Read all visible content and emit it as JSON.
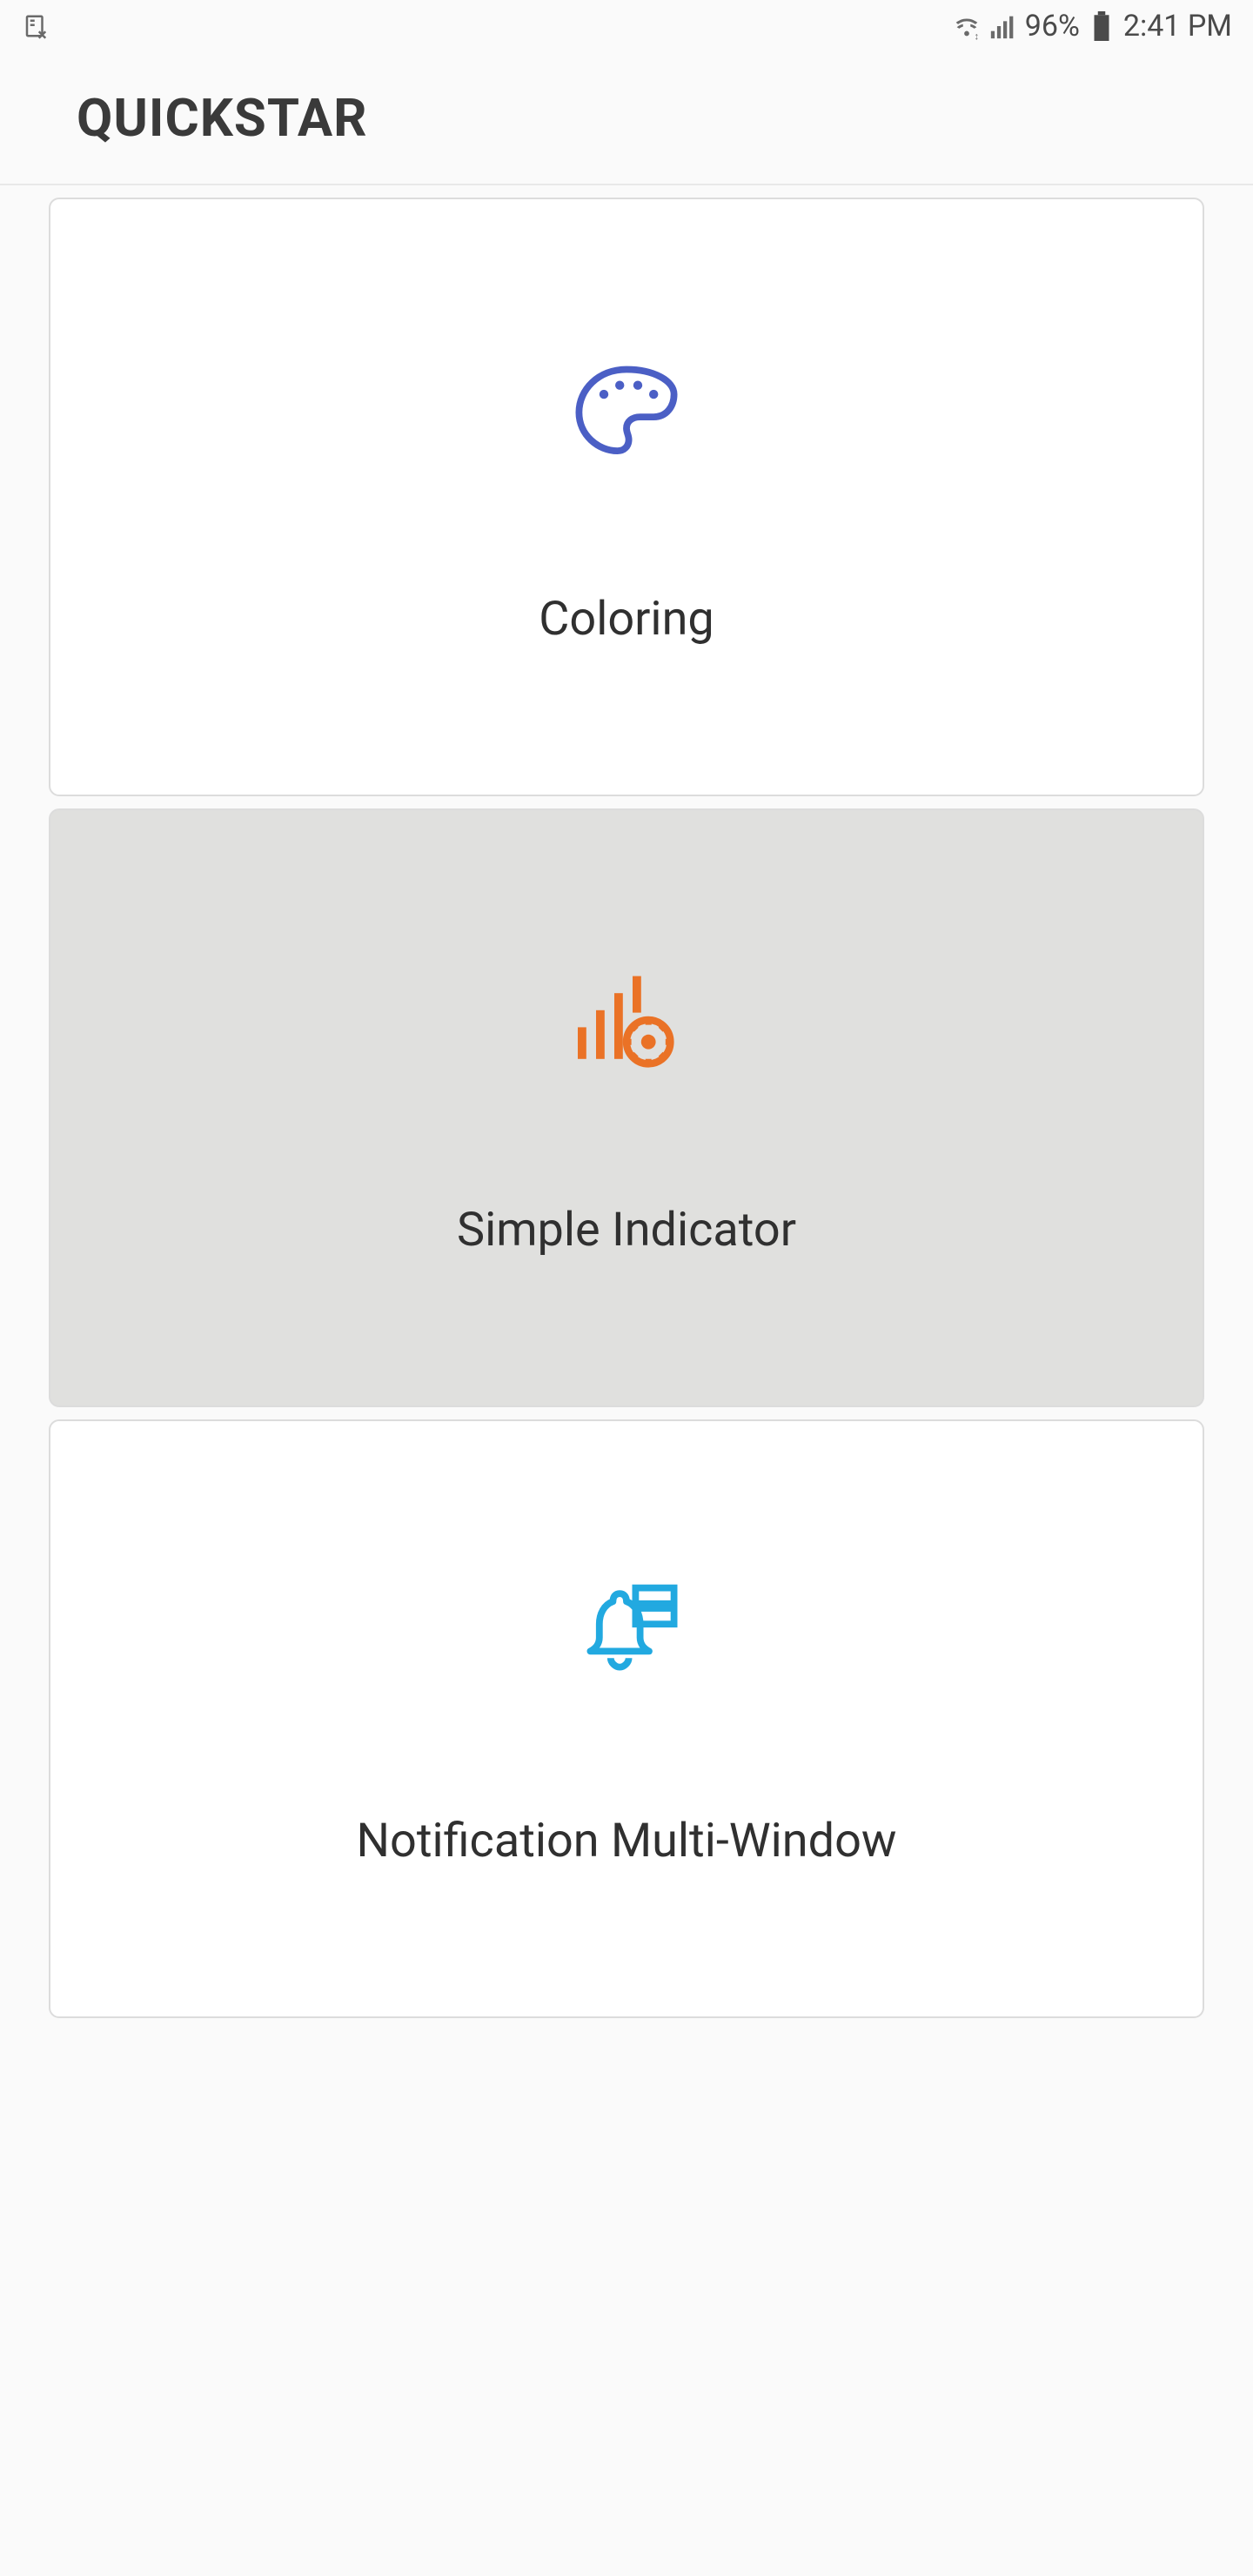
{
  "statusbar": {
    "battery_percent": "96%",
    "time": "2:41 PM"
  },
  "header": {
    "title": "QUICKSTAR"
  },
  "cards": [
    {
      "label": "Coloring",
      "name": "coloring",
      "selected": false
    },
    {
      "label": "Simple Indicator",
      "name": "simple-indicator",
      "selected": true
    },
    {
      "label": "Notification Multi-Window",
      "name": "notification-multi-window",
      "selected": false
    }
  ],
  "colors": {
    "palette_icon": "#4b5fc5",
    "indicator_icon": "#ea7226",
    "notification_icon": "#22a9e0"
  }
}
